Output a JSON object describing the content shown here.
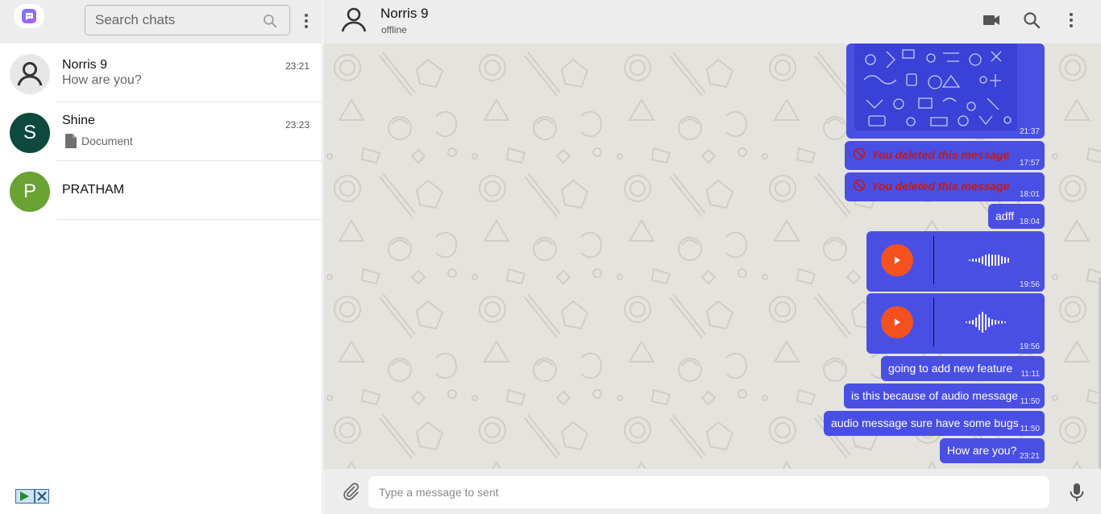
{
  "colors": {
    "header_bg": "#ededed",
    "bubble": "#4a4fe4",
    "deleted_text": "#c01a1a",
    "play_button": "#f4511e",
    "chat_bg": "#e5e3dd"
  },
  "sidebar": {
    "logo_icon": "chat-app-logo-icon",
    "search_placeholder": "Search chats",
    "menu_icon": "more-vert-icon",
    "chats": [
      {
        "name": "Norris 9",
        "time": "23:21",
        "preview": "How are you?",
        "avatar_type": "default-user-icon"
      },
      {
        "name": "Shine",
        "time": "23:23",
        "preview": "Document",
        "avatar_letter": "S",
        "avatar_color": "#0d4a3d",
        "preview_icon": "document-icon"
      },
      {
        "name": "PRATHAM",
        "time": "",
        "preview": "",
        "avatar_letter": "P",
        "avatar_color": "#6aa233"
      }
    ]
  },
  "header": {
    "contact_name": "Norris 9",
    "contact_status": "offline",
    "icons": [
      "video-call-icon",
      "search-icon",
      "more-vert-icon"
    ]
  },
  "messages": [
    {
      "type": "image",
      "time": "21:37"
    },
    {
      "type": "deleted",
      "text": "You deleted this message",
      "time": "17:57"
    },
    {
      "type": "deleted",
      "text": "You deleted this message",
      "time": "18:01"
    },
    {
      "type": "text",
      "text": "adff",
      "time": "18:04"
    },
    {
      "type": "audio",
      "time": "19:56"
    },
    {
      "type": "audio",
      "time": "19:56"
    },
    {
      "type": "text",
      "text": "going to add new feature",
      "time": "11:11"
    },
    {
      "type": "text",
      "text": "is this because of audio message",
      "time": "11:50"
    },
    {
      "type": "text",
      "text": "audio message sure have some bugs",
      "time": "11:50"
    },
    {
      "type": "text",
      "text": "How are you?",
      "time": "23:21"
    }
  ],
  "composer": {
    "placeholder": "Type a message to sent",
    "attach_icon": "paperclip-icon",
    "mic_icon": "microphone-icon"
  }
}
